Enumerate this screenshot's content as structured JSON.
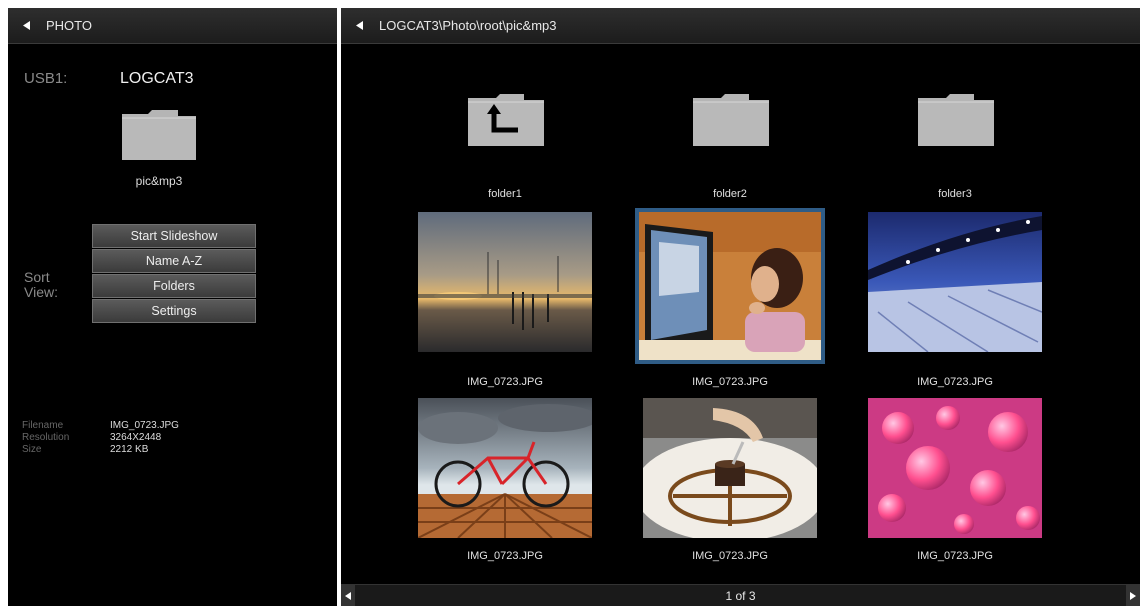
{
  "left": {
    "header_title": "PHOTO",
    "usb_label": "USB1:",
    "usb_name": "LOGCAT3",
    "folder_label": "pic&mp3",
    "sort_label": "Sort",
    "view_label": "View:",
    "menu": [
      {
        "label": "Start Slideshow"
      },
      {
        "label": "Name A-Z"
      },
      {
        "label": "Folders"
      },
      {
        "label": "Settings"
      }
    ],
    "info": [
      {
        "key": "Filename",
        "value": "IMG_0723.JPG"
      },
      {
        "key": "Resolution",
        "value": "3264X2448"
      },
      {
        "key": "Size",
        "value": "2212 KB"
      }
    ]
  },
  "right": {
    "path": "LOGCAT3\\Photo\\root\\pic&mp3",
    "folders": [
      {
        "label": "folder1",
        "icon": "folder-up-icon"
      },
      {
        "label": "folder2",
        "icon": "folder-icon"
      },
      {
        "label": "folder3",
        "icon": "folder-icon"
      }
    ],
    "photos": [
      {
        "label": "IMG_0723.JPG",
        "subject": "sunset-pier"
      },
      {
        "label": "IMG_0723.JPG",
        "subject": "child-at-computer",
        "selected": true
      },
      {
        "label": "IMG_0723.JPG",
        "subject": "night-bridge"
      },
      {
        "label": "IMG_0723.JPG",
        "subject": "red-bicycle"
      },
      {
        "label": "IMG_0723.JPG",
        "subject": "dessert-plate"
      },
      {
        "label": "IMG_0723.JPG",
        "subject": "pink-bubbles"
      }
    ],
    "pager": "1 of 3"
  },
  "colors": {
    "selection": "#2f5c86",
    "folder": "#b5b5b5"
  }
}
